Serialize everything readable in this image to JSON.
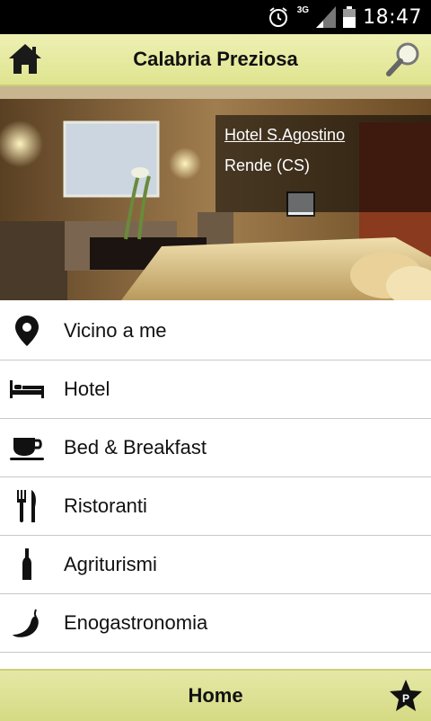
{
  "status_bar": {
    "time": "18:47",
    "network": "3G"
  },
  "app_bar": {
    "title": "Calabria Preziosa"
  },
  "hero": {
    "hotel_name": "Hotel S.Agostino",
    "city": "Rende (CS)"
  },
  "menu": [
    {
      "label": "Vicino a me",
      "icon": "location-pin-icon"
    },
    {
      "label": "Hotel",
      "icon": "bed-icon"
    },
    {
      "label": "Bed & Breakfast",
      "icon": "coffee-cup-icon"
    },
    {
      "label": "Ristoranti",
      "icon": "fork-knife-icon"
    },
    {
      "label": "Agriturismi",
      "icon": "wine-bottle-icon"
    },
    {
      "label": "Enogastronomia",
      "icon": "chili-pepper-icon"
    },
    {
      "label": "",
      "icon": "partial-icon"
    }
  ],
  "bottom_bar": {
    "label": "Home",
    "badge": "P"
  }
}
